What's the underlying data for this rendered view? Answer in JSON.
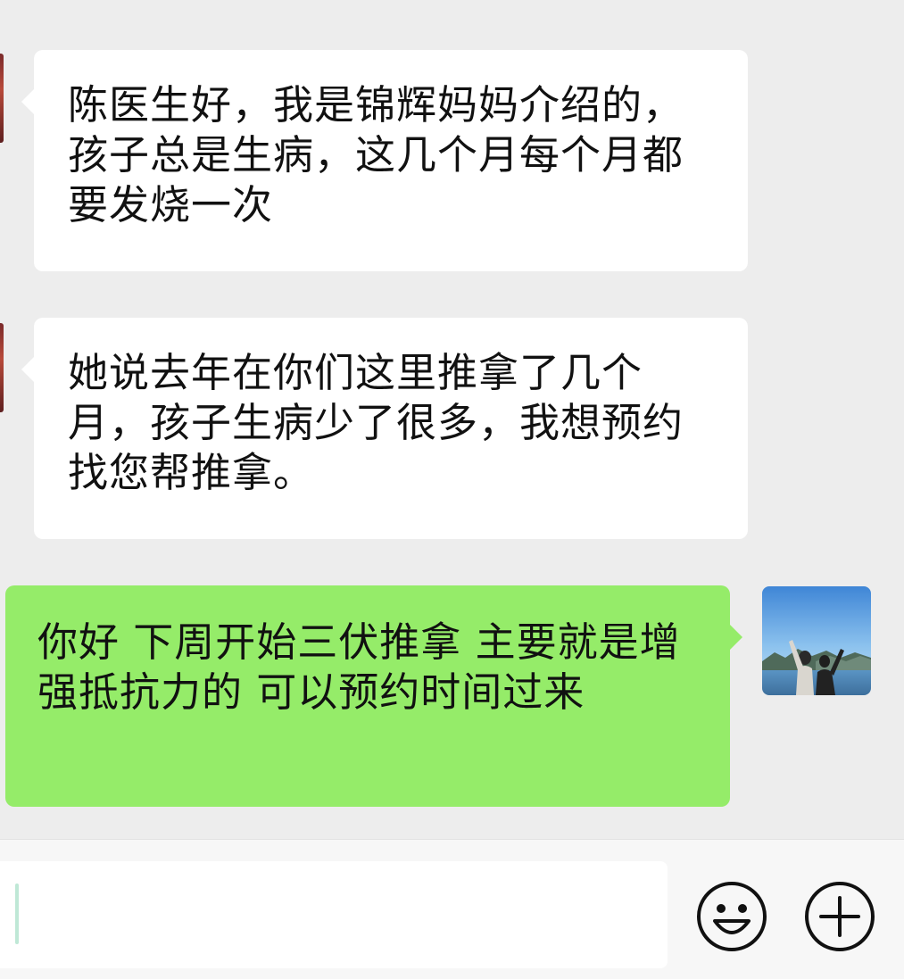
{
  "messages": [
    {
      "direction": "incoming",
      "text": "陈医生好，我是锦辉妈妈介绍的，孩子总是生病，这几个月每个月都要发烧一次"
    },
    {
      "direction": "incoming",
      "text": "她说去年在你们这里推拿了几个月，孩子生病少了很多，我想预约找您帮推拿。"
    },
    {
      "direction": "outgoing",
      "text": "你好 下周开始三伏推拿 主要就是增强抵抗力的 可以预约时间过来"
    }
  ],
  "input": {
    "value": "",
    "placeholder": ""
  },
  "icons": {
    "emoji": "smiley-face-icon",
    "more": "plus-circle-icon",
    "avatar": "user-avatar-photo"
  },
  "colors": {
    "chat_background": "#ededed",
    "incoming_bubble": "#ffffff",
    "outgoing_bubble": "#95ec69",
    "input_bar": "#f7f7f7"
  }
}
